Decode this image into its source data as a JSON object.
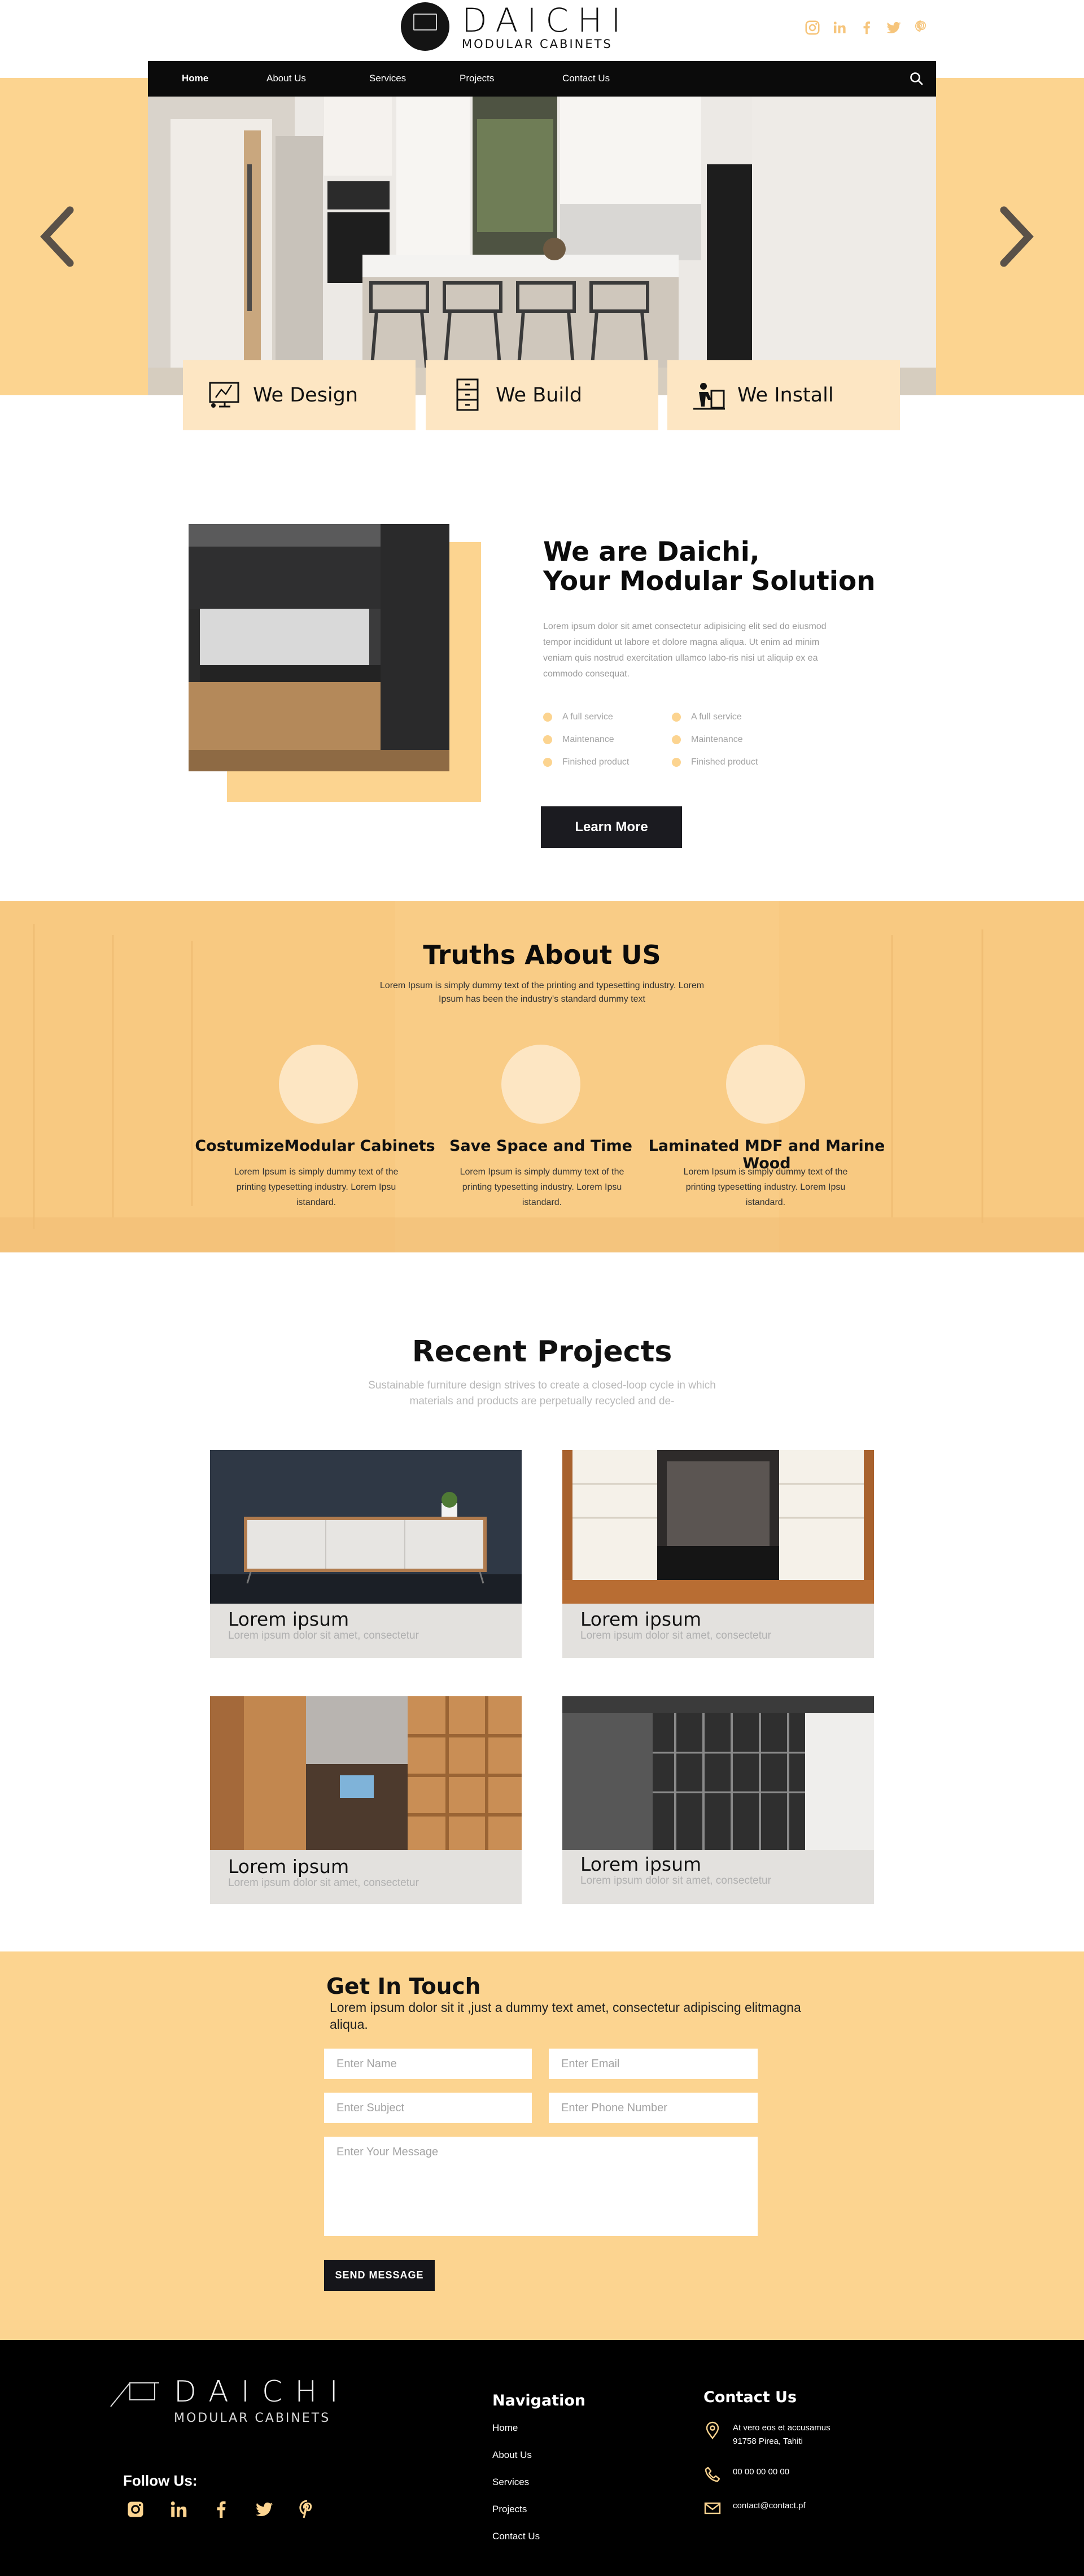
{
  "brand": {
    "name": "DAICHI",
    "tagline": "MODULAR CABINETS",
    "accent": "#fcd490",
    "dark": "#0b0b0b"
  },
  "header": {
    "social_icons": [
      "instagram-icon",
      "linkedin-icon",
      "facebook-icon",
      "twitter-icon",
      "pinterest-icon"
    ]
  },
  "nav": {
    "items": [
      {
        "label": "Home",
        "active": true
      },
      {
        "label": "About Us",
        "active": false
      },
      {
        "label": "Services",
        "active": false
      },
      {
        "label": "Projects",
        "active": false
      },
      {
        "label": "Contact Us",
        "active": false
      }
    ]
  },
  "features": [
    {
      "label": "We Design",
      "icon": "design-monitor-icon"
    },
    {
      "label": "We Build",
      "icon": "cabinet-drawers-icon"
    },
    {
      "label": "We Install",
      "icon": "install-worker-icon"
    }
  ],
  "about": {
    "title_line1": "We are Daichi,",
    "title_line2": "Your Modular Solution",
    "body": "Lorem ipsum dolor sit amet consectetur adipisicing elit sed do eiusmod tempor incididunt ut labore et dolore magna aliqua. Ut enim ad minim veniam quis nostrud exercitation ullamco labo-ris nisi ut aliquip ex ea commodo consequat.",
    "list_left": [
      "A full service",
      "Maintenance",
      "Finished product"
    ],
    "list_right": [
      "A full service",
      "Maintenance",
      "Finished product"
    ],
    "button": "Learn More"
  },
  "truths": {
    "title": "Truths About US",
    "subtitle": "Lorem Ipsum is simply dummy text of the printing and typesetting industry. Lorem Ipsum has been the industry's standard dummy text",
    "items": [
      {
        "title": "CostumizeModular Cabinets",
        "text": "Lorem Ipsum is simply dummy text of the printing typesetting industry. Lorem Ipsu istandard."
      },
      {
        "title": "Save Space and Time",
        "text": "Lorem Ipsum is simply dummy text of the printing typesetting industry. Lorem Ipsu istandard."
      },
      {
        "title": "Laminated MDF and Marine Wood",
        "text": "Lorem Ipsum is simply dummy text of the printing typesetting industry. Lorem Ipsu istandard."
      }
    ]
  },
  "projects": {
    "title": "Recent Projects",
    "subtitle": "Sustainable furniture design strives to create a closed-loop cycle in which materials and products are perpetually recycled and de-",
    "items": [
      {
        "title": "Lorem ipsum",
        "text": "Lorem ipsum dolor sit amet, consectetur"
      },
      {
        "title": "Lorem ipsum",
        "text": "Lorem ipsum dolor sit amet, consectetur"
      },
      {
        "title": "Lorem ipsum",
        "text": "Lorem ipsum dolor sit amet, consectetur"
      },
      {
        "title": "Lorem ipsum",
        "text": "Lorem ipsum dolor sit amet, consectetur"
      }
    ]
  },
  "contact": {
    "title": "Get In Touch",
    "text": "Lorem ipsum dolor sit  it ,just a dummy text amet, consectetur adipiscing elitmagna aliqua.",
    "placeholders": {
      "name": "Enter Name",
      "email": "Enter Email",
      "subject": "Enter Subject",
      "phone": "Enter Phone Number",
      "message": "Enter Your Message"
    },
    "button": "SEND MESSAGE"
  },
  "footer": {
    "follow": "Follow Us:",
    "nav_title": "Navigation",
    "nav_links": [
      "Home",
      "About Us",
      "Services",
      "Projects",
      "Contact Us"
    ],
    "contact_title": "Contact Us",
    "address": "At vero eos et accusamus",
    "address2": "91758 Pirea, Tahiti",
    "phone": "00 00 00 00 00",
    "email": "contact@contact.pf"
  }
}
